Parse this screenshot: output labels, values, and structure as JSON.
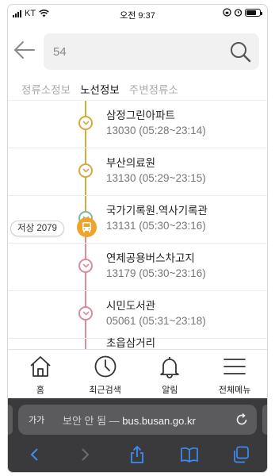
{
  "status_bar": {
    "carrier": "KT",
    "time": "오전 9:37"
  },
  "search": {
    "value": "54",
    "placeholder": ""
  },
  "tabs": [
    {
      "label": "정류소정보",
      "active": false
    },
    {
      "label": "노선정보",
      "active": true
    },
    {
      "label": "주변정류소",
      "active": false
    }
  ],
  "stops": [
    {
      "name": "삼정그린아파트",
      "info": "13030 (05:28~23:14)",
      "color": "#d7aa3e"
    },
    {
      "name": "부산의료원",
      "info": "13130 (05:29~23:15)",
      "color": "#d7aa3e"
    },
    {
      "name": "국가기록원.역사기록관",
      "info": "13131 (05:30~23:16)",
      "color": "#7fb89a"
    },
    {
      "name": "연제공용버스차고지",
      "info": "13179 (05:30~23:16)",
      "color": "#de8a9b"
    },
    {
      "name": "시민도서관",
      "info": "05061 (05:31~23:18)",
      "color": "#de8a9b"
    },
    {
      "name": "초읍삼거리",
      "info": "",
      "color": "#de8a9b"
    }
  ],
  "bus_marker": {
    "label": "저상 2079"
  },
  "bottom_nav": [
    {
      "label": "홈",
      "icon": "home-icon"
    },
    {
      "label": "최근검색",
      "icon": "clock-icon"
    },
    {
      "label": "알림",
      "icon": "bell-icon"
    },
    {
      "label": "전체메뉴",
      "icon": "menu-icon"
    }
  ],
  "browser": {
    "text_size": "가가",
    "security": "보안 안 됨 — ",
    "host": "bus.busan.go.kr"
  },
  "colors": {
    "route_yellow": "#d7aa3e",
    "route_pink": "#de8a9b",
    "bus_orange": "#f0a22a"
  }
}
